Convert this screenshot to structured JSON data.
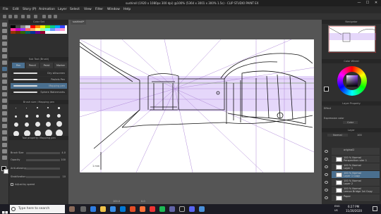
{
  "window": {
    "title": "sushiroll (1920 x 1080px 300 dpi) @100% (5364 x 3001 x 300% 1.5s) - CLIP STUDIO PAINT EX",
    "min": "—",
    "max": "☐",
    "close": "✕"
  },
  "menu": [
    "File",
    "Edit",
    "Story (P)",
    "Animation",
    "Layer",
    "Select",
    "View",
    "Filter",
    "Window",
    "Help"
  ],
  "canvas_tab": "sushiroll*",
  "left": {
    "color_set_header": "Color Set",
    "sub_tool_header": "Sub Tool (Brush)",
    "brush_tabs": [
      "Pen",
      "Pencil",
      "Paint",
      "Marker"
    ],
    "brushes": [
      "Dry silkscreen",
      "Pastels Pen",
      "Mapping pen",
      "Sphere Watermarks"
    ],
    "brush_size_header": "Brush size / Mapping pen",
    "brush_sizes": [
      "0.7",
      "1",
      "1.5",
      "2",
      "2.5",
      "3",
      "4",
      "5",
      "6",
      "7",
      "8",
      "10",
      "12",
      "15",
      "20",
      "25",
      "30",
      "40",
      "50",
      "60"
    ],
    "tool_prop_header": "Tool property: Mapping pen",
    "props": [
      {
        "label": "Brush Size",
        "value": "4.0"
      },
      {
        "label": "Opacity",
        "value": "100"
      },
      {
        "label": "Anti-aliasing",
        "value": ""
      },
      {
        "label": "Stabilization",
        "value": "10"
      }
    ],
    "adjust_speed": "Adjust by speed"
  },
  "canvas": {
    "scale_label": "1 mm",
    "zoom": "100.0",
    "angle": "0.0"
  },
  "right": {
    "navigator_header": "Navigator",
    "color_wheel_header": "Color Wheel",
    "layer_prop_header": "Layer Property",
    "effect_label": "Effect",
    "expression_label": "Expression color",
    "expression_value": "Color",
    "layer_header": "Layer",
    "blend_mode": "Normal",
    "opacity": "100",
    "layers": [
      {
        "name": "original2",
        "sel": false
      },
      {
        "name": "100 % Normal\nPerspective ruler 1",
        "sel": false
      },
      {
        "name": "100 % Normal\nLayer 1",
        "sel": false
      },
      {
        "name": "100 % Normal\nLayer 1 Copy",
        "sel": true
      },
      {
        "name": "100 % Normal\nLayer 2",
        "sel": false
      },
      {
        "name": "100 % Normal\nLemon Bridge 1st Copy",
        "sel": false
      },
      {
        "name": "Paper",
        "sel": false
      }
    ]
  },
  "taskbar": {
    "search": "Type here to search",
    "lang": "ENG\nUS",
    "time": "6:27 PM",
    "date": "11/20/2020"
  },
  "colors": {
    "selection_tint": "#b48cf0",
    "accent": "#4a6f8f"
  }
}
